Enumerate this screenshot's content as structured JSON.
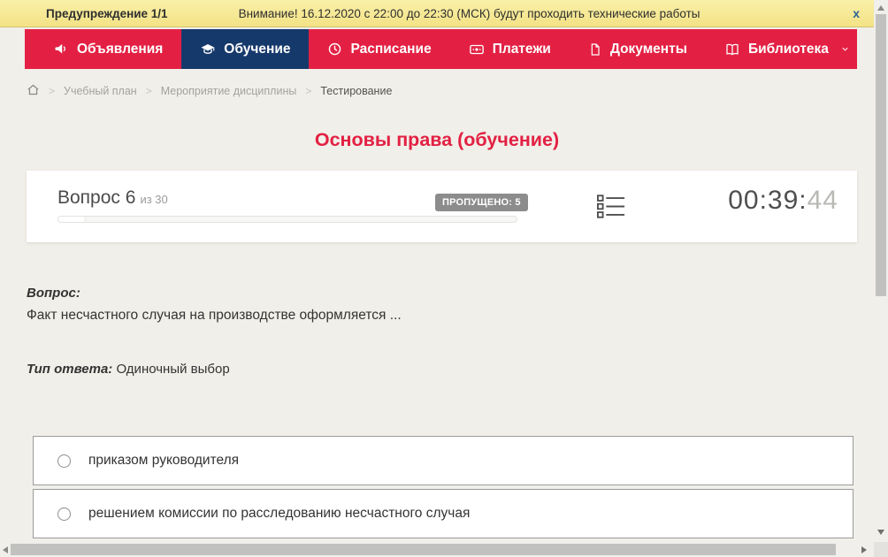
{
  "warning_bar": {
    "label": "Предупреждение 1/1",
    "message": "Внимание! 16.12.2020 с 22:00 до 22:30 (МСК) будут проходить технические работы",
    "close_label": "x"
  },
  "nav": {
    "items": [
      {
        "label": "Объявления",
        "icon": "megaphone-icon",
        "active": false
      },
      {
        "label": "Обучение",
        "icon": "graduation-cap-icon",
        "active": true
      },
      {
        "label": "Расписание",
        "icon": "clock-icon",
        "active": false
      },
      {
        "label": "Платежи",
        "icon": "credit-card-icon",
        "active": false
      },
      {
        "label": "Документы",
        "icon": "document-icon",
        "active": false
      },
      {
        "label": "Библиотека",
        "icon": "book-icon",
        "active": false,
        "has_dropdown": true
      }
    ]
  },
  "breadcrumb": {
    "items": [
      "Учебный план",
      "Мероприятие дисциплины",
      "Тестирование"
    ]
  },
  "page_title": "Основы права (обучение)",
  "question_panel": {
    "question_label": "Вопрос 6",
    "question_of": "из 30",
    "skipped_badge": "ПРОПУЩЕНО: 5",
    "progress_percent": 6,
    "timer": {
      "main": "00:39:",
      "seconds": "44"
    }
  },
  "question": {
    "label": "Вопрос:",
    "text": "Факт несчастного случая на производстве оформляется ...",
    "type_label": "Тип ответа:",
    "type_value": "Одиночный выбор"
  },
  "answers": [
    {
      "label": "приказом руководителя",
      "selected": false
    },
    {
      "label": "решением комиссии по расследованию несчастного случая",
      "selected": false
    }
  ],
  "colors": {
    "accent_red": "#e32043",
    "active_navy": "#16396b",
    "warning_yellow": "#f3e286",
    "badge_gray": "#8c8c8c"
  }
}
